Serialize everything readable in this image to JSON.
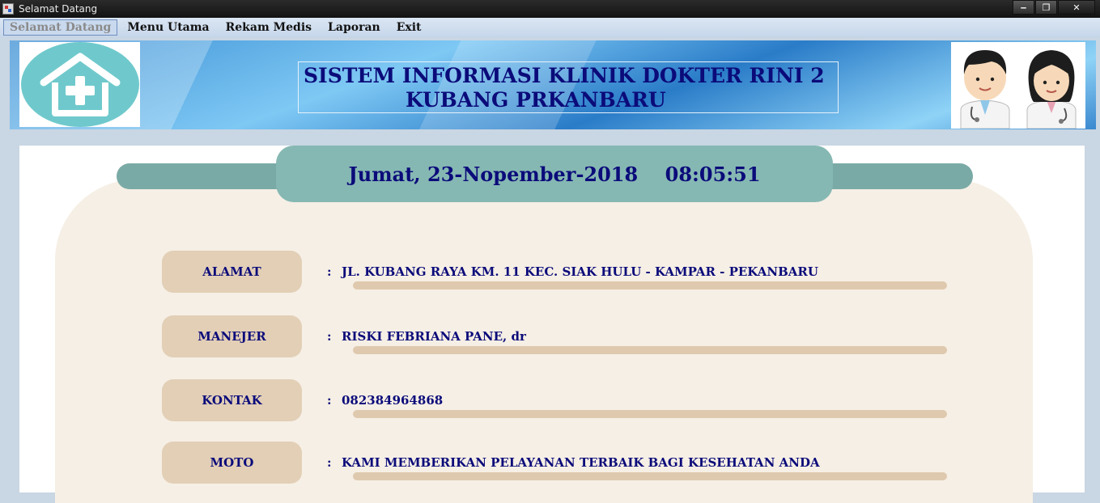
{
  "window": {
    "title": "Selamat Datang",
    "buttons": {
      "minimize": "‒",
      "maximize": "❐",
      "close": "✕"
    }
  },
  "menu": {
    "items": [
      "Selamat Datang",
      "Menu Utama",
      "Rekam Medis",
      "Laporan",
      "Exit"
    ]
  },
  "header": {
    "title_line1": "SISTEM INFORMASI KLINIK DOKTER RINI 2",
    "title_line2": "KUBANG PRKANBARU",
    "logo_icon": "clinic-house-cross-icon",
    "doctors_icon": "doctors-illustration-icon"
  },
  "main": {
    "datetime": "Jumat, 23-Nopember-2018    08:05:51",
    "rows": [
      {
        "label": "ALAMAT",
        "colon": ":",
        "value": "JL. KUBANG RAYA KM. 11 KEC. SIAK HULU - KAMPAR - PEKANBARU"
      },
      {
        "label": "MANEJER",
        "colon": ":",
        "value": "RISKI FEBRIANA PANE, dr"
      },
      {
        "label": "KONTAK",
        "colon": ":",
        "value": "082384964868"
      },
      {
        "label": "MOTO",
        "colon": ":",
        "value": "KAMI MEMBERIKAN PELAYANAN TERBAIK BAGI KESEHATAN ANDA"
      }
    ]
  },
  "colors": {
    "text_navy": "#0b0b7a",
    "ribbon_teal": "#86b8b3",
    "label_tan": "#e2cfb6",
    "card_cream": "#f6efe5",
    "banner_blue": "#3c8fd4"
  }
}
